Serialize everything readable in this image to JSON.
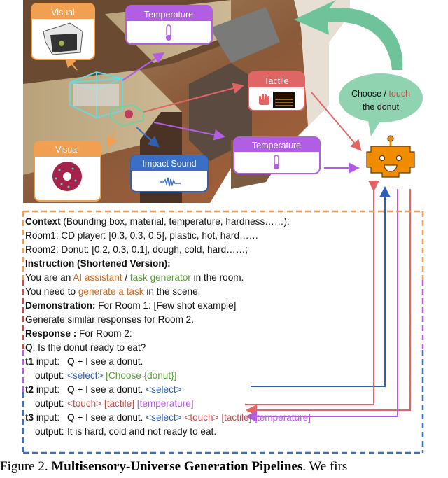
{
  "figure": {
    "cards": {
      "visual_top": {
        "title": "Visual",
        "color": "#f0a050"
      },
      "temperature_top": {
        "title": "Temperature",
        "color": "#b15ee5"
      },
      "tactile": {
        "title": "Tactile",
        "color": "#e06666"
      },
      "temperature_mid": {
        "title": "Temperature",
        "color": "#b15ee5"
      },
      "visual_bottom": {
        "title": "Visual",
        "color": "#f0a050"
      },
      "impact_sound": {
        "title": "Impact Sound",
        "color": "#3a6fc4"
      }
    },
    "speech_bubble": {
      "text_part1": "Choose / ",
      "text_highlight": "touch",
      "text_part2": "the donut",
      "color": "#8fd3b0"
    },
    "robot": {
      "color": "#f08c00"
    }
  },
  "prompt": {
    "context_label": "Context",
    "context_text": " (Bounding box, material, temperature, hardness……):",
    "room1": "Room1: CD player: [0.3, 0.3, 0.5], plastic, hot, hard……",
    "room2": "Room2: Donut: [0.2, 0.3, 0.1], dough, cold, hard……;",
    "instruction_label": "Instruction (Shortened Version):",
    "you_are_an": "You are an  ",
    "ai_assistant": "AI assistant",
    "slash": " / ",
    "task_generator": "task generator",
    "in_the_room": " in the room.",
    "you_need_to": "You need to ",
    "generate_a_task": "generate a task",
    "in_the_scene": " in the scene.",
    "demonstration_label": "Demonstration:",
    "demonstration_text": " For Room 1: [Few shot example]",
    "generate_similar": "Generate similar responses for Room 2.",
    "response_label": "Response :",
    "response_text": " For Room 2:",
    "question": "Q: Is the donut ready to eat?",
    "t1_label": "t1",
    "t2_label": "t2",
    "t3_label": "t3",
    "input_label": " input:",
    "output_label": "output:",
    "t1_input": "Q + I see a donut.",
    "t1_output_select": "<select>",
    "t1_output_choose": " [Choose {donut}]",
    "t2_input": "Q + I see a donut. ",
    "t2_input_select": "<select>",
    "t2_output_touch": "<touch>",
    "t2_output_tactile": " [tactile]",
    "t2_output_temperature": " [temperature]",
    "t3_input": "Q + I see a donut. ",
    "t3_input_select": "<select>",
    "t3_input_touch": " <touch>",
    "t3_input_tactile": " [tactile]",
    "t3_input_temperature": " [temperature]",
    "t3_output": "It is hard, cold and not ready to eat."
  },
  "caption": {
    "prefix": "Figure 2. ",
    "bold": "Multisensory-Universe Generation Pipelines",
    "suffix": ". We firs"
  }
}
